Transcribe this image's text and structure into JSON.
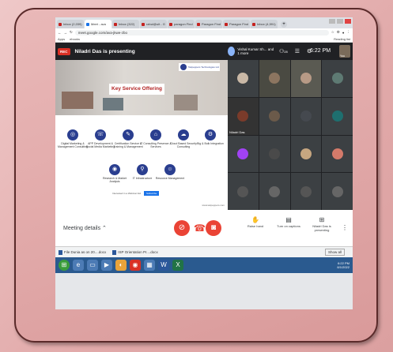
{
  "browser": {
    "tabs": [
      {
        "label": "Inbox (2,039)",
        "active": false
      },
      {
        "label": "Meet - ava",
        "active": true
      },
      {
        "label": "Inbox (322)",
        "active": false
      },
      {
        "label": "rahul@uit - G",
        "active": false
      },
      {
        "label": "paragon Find",
        "active": false
      },
      {
        "label": "Paragon Find",
        "active": false
      },
      {
        "label": "Paragon Find",
        "active": false
      },
      {
        "label": "Inbox (4,591)",
        "active": false
      }
    ],
    "new_tab": "+",
    "url": "meet.google.com/ava-jkwe-zbo",
    "bookmarks": [
      "Apps",
      "ebooks"
    ],
    "reading_list": "Reading list"
  },
  "meet": {
    "rec_label": "REC",
    "presenting_text": "Niladri Das is presenting",
    "host_pill": "Vishal Kumar Sh... and 1 more",
    "participant_count": "28",
    "time": "6:22 PM",
    "you_label": "You",
    "slide": {
      "logo_text": "Tekpeppers Technologies Ltd",
      "title": "Key Service Offering",
      "services": [
        "Digital Marketing & Management Consulting",
        "APP Development & Social Media Marketing",
        "Certification Service & Training & Management",
        "IT Consulting Presence & Services",
        "Cloud Based Security Consulting",
        "Big & Bulk Integration",
        "Research & Market Analysis",
        "IT Infrastructure",
        "Resource Management"
      ],
      "footer_text": "Interested in a Webinar Aid",
      "footer_button": "Subscribe",
      "footer_link": "www.tekpeppers.com"
    },
    "tiles": [
      {
        "label": ""
      },
      {
        "label": ""
      },
      {
        "label": ""
      },
      {
        "label": ""
      },
      {
        "label": "Niladri Das"
      },
      {
        "label": ""
      },
      {
        "label": ""
      },
      {
        "label": ""
      },
      {
        "label": ""
      },
      {
        "label": ""
      },
      {
        "label": ""
      },
      {
        "label": ""
      },
      {
        "label": ""
      },
      {
        "label": ""
      },
      {
        "label": ""
      },
      {
        "label": ""
      }
    ],
    "meeting_details": "Meeting details",
    "raise_hand": "Raise hand",
    "captions": "Turn on captions",
    "presenter_status": "Niladri Das is presenting"
  },
  "downloads": {
    "files": [
      "File Dunia as on 20....docx",
      "ISP Orientation Pr....docx"
    ],
    "show_all": "Show all"
  },
  "taskbar": {
    "time": "6:22 PM",
    "date": "8/1/2022"
  }
}
